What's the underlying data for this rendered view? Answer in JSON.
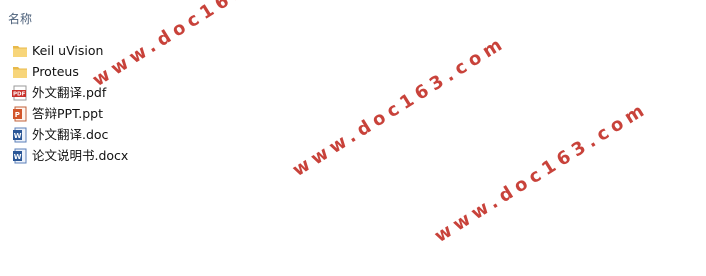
{
  "explorer": {
    "column_header": "名称",
    "items": [
      {
        "name": "Keil uVision",
        "icon": "folder-icon"
      },
      {
        "name": "Proteus",
        "icon": "folder-icon"
      },
      {
        "name": "外文翻译.pdf",
        "icon": "pdf-icon"
      },
      {
        "name": "答辩PPT.ppt",
        "icon": "ppt-icon"
      },
      {
        "name": "外文翻译.doc",
        "icon": "doc-icon"
      },
      {
        "name": "论文说明书.docx",
        "icon": "docx-icon"
      }
    ]
  },
  "watermarks": [
    "www.doc163.com",
    "www.doc163.com",
    "www.doc163.com"
  ],
  "colors": {
    "folder": "#f5cf6b",
    "pdf": "#c8312b",
    "ppt": "#d2562b",
    "word": "#2b5797",
    "watermark": "#c4322a"
  }
}
